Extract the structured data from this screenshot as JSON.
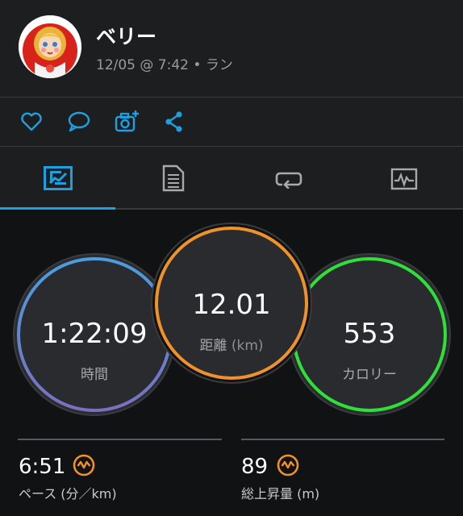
{
  "user": {
    "name": "ベリー",
    "date_time": "12/05 @ 7:42",
    "separator": "•",
    "activity_type": "ラン"
  },
  "actions": [
    {
      "icon": "heart-icon"
    },
    {
      "icon": "comment-icon"
    },
    {
      "icon": "add-photo-icon"
    },
    {
      "icon": "share-icon"
    }
  ],
  "tabs": [
    {
      "icon": "stats-icon",
      "selected": true
    },
    {
      "icon": "details-icon",
      "selected": false
    },
    {
      "icon": "laps-icon",
      "selected": false
    },
    {
      "icon": "chart-icon",
      "selected": false
    }
  ],
  "stats": {
    "time": {
      "value": "1:22:09",
      "label": "時間",
      "ring_colors": [
        "#4a9ee0",
        "#7b6fc2"
      ]
    },
    "distance": {
      "value": "12.01",
      "label": "距離",
      "unit": "(km)",
      "ring_color": "#f0922a"
    },
    "calories": {
      "value": "553",
      "label": "カロリー",
      "ring_color": "#2fe03b"
    }
  },
  "metrics": {
    "pace": {
      "value": "6:51",
      "label": "ペース (分／km)",
      "icon": "pace-gauge-icon"
    },
    "elevation_gain": {
      "value": "89",
      "label": "総上昇量 (m)",
      "icon": "elevation-gauge-icon"
    }
  },
  "colors": {
    "accent": "#1e9fe0",
    "badge": "#f0922a",
    "background": "#111214",
    "panel": "#1d1e20"
  }
}
